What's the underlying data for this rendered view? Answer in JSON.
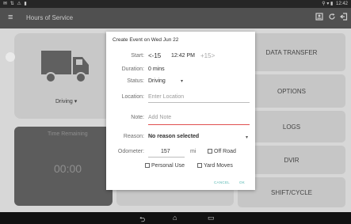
{
  "status_bar": {
    "time": "12:42"
  },
  "app_bar": {
    "title": "Hours of Service",
    "icons": [
      "menu-icon",
      "id-card-icon",
      "refresh-icon",
      "logout-icon"
    ]
  },
  "truck_card": {
    "status": "Driving",
    "caret": "▾"
  },
  "time_card": {
    "label": "Time Remaining",
    "value": "00:00"
  },
  "right_buttons": [
    "DATA TRANSFER",
    "OPTIONS",
    "LOGS",
    "DVIR",
    "SHIFT/CYCLE"
  ],
  "dialog": {
    "title": "Create Event on Wed Jun 22",
    "start": {
      "label": "Start:",
      "prev": "<-15",
      "time": "12:42 PM",
      "next": "+15>"
    },
    "duration": {
      "label": "Duration:",
      "value": "0 mins"
    },
    "status": {
      "label": "Status:",
      "value": "Driving"
    },
    "location": {
      "label": "Location:",
      "placeholder": "Enter Location"
    },
    "note": {
      "label": "Note:",
      "placeholder": "Add Note"
    },
    "reason": {
      "label": "Reason:",
      "value": "No reason selected"
    },
    "odometer": {
      "label": "Odometer:",
      "value": "157",
      "unit": "mi"
    },
    "off_road": "Off Road",
    "personal_use": "Personal Use",
    "yard_moves": "Yard Moves",
    "cancel": "CANCEL",
    "ok": "OK"
  },
  "colors": {
    "accent": "#55b7b2",
    "error_underline": "#e05050",
    "appbar": "#505050"
  }
}
